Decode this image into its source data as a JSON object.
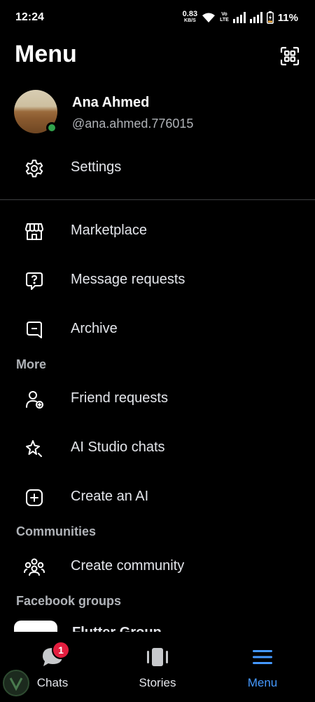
{
  "status_bar": {
    "time": "12:24",
    "net_speed": "0.83",
    "net_unit": "KB/S",
    "volte_line1": "Vo",
    "volte_line2": "LTE",
    "battery": "11%"
  },
  "header": {
    "title": "Menu",
    "qr_icon": "qr-code-icon"
  },
  "profile": {
    "name": "Ana Ahmed",
    "handle": "@ana.ahmed.776015",
    "online_color": "#31a24c"
  },
  "menu": {
    "settings": "Settings",
    "marketplace": "Marketplace",
    "message_requests": "Message requests",
    "archive": "Archive"
  },
  "sections": {
    "more": {
      "title": "More",
      "friend_requests": "Friend requests",
      "ai_studio": "AI Studio chats",
      "create_ai": "Create an AI"
    },
    "communities": {
      "title": "Communities",
      "create_community": "Create community"
    },
    "facebook_groups": {
      "title": "Facebook groups",
      "first_group": "Flutter Group"
    }
  },
  "bottom_nav": {
    "chats": {
      "label": "Chats",
      "badge": "1"
    },
    "stories": {
      "label": "Stories"
    },
    "menu": {
      "label": "Menu",
      "active": true
    }
  },
  "colors": {
    "accent": "#4599ff",
    "badge": "#e41e3f",
    "background": "#000000"
  }
}
